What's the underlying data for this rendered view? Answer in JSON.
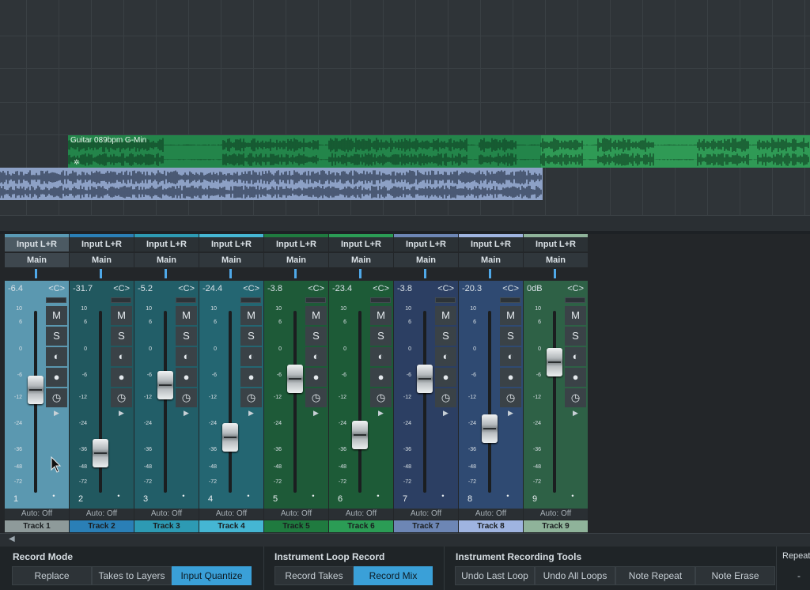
{
  "arrange": {
    "clips": [
      {
        "name": "Guitar 089bpm G-Min",
        "color": "#2f9a55"
      },
      {
        "name": "",
        "color": "#8da1c6"
      }
    ]
  },
  "mixer": {
    "channels": [
      {
        "input": "Input L+R",
        "output": "Main",
        "volume": "-6.4",
        "pan": "<C>",
        "fader_db": -6.4,
        "number": "1",
        "automation": "Auto: Off",
        "name": "Track 1",
        "strip_color": "#5b98b0",
        "name_color": "#8e9a9a",
        "top_color": "#5a9ab5"
      },
      {
        "input": "Input L+R",
        "output": "Main",
        "volume": "-31.7",
        "pan": "<C>",
        "fader_db": -31.7,
        "number": "2",
        "automation": "Auto: Off",
        "name": "Track 2",
        "strip_color": "#21585f",
        "name_color": "#2a7fb6",
        "top_color": "#2a7fb6"
      },
      {
        "input": "Input L+R",
        "output": "Main",
        "volume": "-5.2",
        "pan": "<C>",
        "fader_db": -5.2,
        "number": "3",
        "automation": "Auto: Off",
        "name": "Track 3",
        "strip_color": "#225e68",
        "name_color": "#2d9ab3",
        "top_color": "#2d9ab3"
      },
      {
        "input": "Input L+R",
        "output": "Main",
        "volume": "-24.4",
        "pan": "<C>",
        "fader_db": -24.4,
        "number": "4",
        "automation": "Auto: Off",
        "name": "Track 4",
        "strip_color": "#246672",
        "name_color": "#45b6d3",
        "top_color": "#45b6d3"
      },
      {
        "input": "Input L+R",
        "output": "Main",
        "volume": "-3.8",
        "pan": "<C>",
        "fader_db": -3.8,
        "number": "5",
        "automation": "Auto: Off",
        "name": "Track 5",
        "strip_color": "#1e5a38",
        "name_color": "#1f7a3f",
        "top_color": "#1f7a3f"
      },
      {
        "input": "Input L+R",
        "output": "Main",
        "volume": "-23.4",
        "pan": "<C>",
        "fader_db": -23.4,
        "number": "6",
        "automation": "Auto: Off",
        "name": "Track 6",
        "strip_color": "#1d5b37",
        "name_color": "#2b9c55",
        "top_color": "#2b9c55"
      },
      {
        "input": "Input L+R",
        "output": "Main",
        "volume": "-3.8",
        "pan": "<C>",
        "fader_db": -3.8,
        "number": "7",
        "automation": "Auto: Off",
        "name": "Track 7",
        "strip_color": "#2c3f63",
        "name_color": "#6d86b5",
        "top_color": "#6d86b5"
      },
      {
        "input": "Input L+R",
        "output": "Main",
        "volume": "-20.3",
        "pan": "<C>",
        "fader_db": -20.3,
        "number": "8",
        "automation": "Auto: Off",
        "name": "Track 8",
        "strip_color": "#2f4a72",
        "name_color": "#9fb4e0",
        "top_color": "#9fb4e0"
      },
      {
        "input": "Input L+R",
        "output": "Main",
        "volume": "0dB",
        "pan": "<C>",
        "fader_db": 0,
        "number": "9",
        "automation": "Auto: Off",
        "name": "Track 9",
        "strip_color": "#2e6146",
        "name_color": "#8fb39a",
        "top_color": "#8fb39a"
      }
    ],
    "scale": [
      "10",
      "6",
      "0",
      "-6",
      "-12",
      "-24",
      "-36",
      "-48",
      "-72"
    ],
    "buttons": [
      "M",
      "S",
      "◐",
      "●",
      "◷"
    ]
  },
  "bottom": {
    "record_mode": {
      "title": "Record Mode",
      "buttons": [
        {
          "label": "Replace",
          "active": false
        },
        {
          "label": "Takes to Layers",
          "active": false
        },
        {
          "label": "Input Quantize",
          "active": true
        }
      ]
    },
    "loop_record": {
      "title": "Instrument Loop Record",
      "buttons": [
        {
          "label": "Record Takes",
          "active": false
        },
        {
          "label": "Record Mix",
          "active": true
        }
      ]
    },
    "tools": {
      "title": "Instrument Recording Tools",
      "buttons": [
        {
          "label": "Undo Last Loop"
        },
        {
          "label": "Undo All Loops"
        },
        {
          "label": "Note Repeat"
        },
        {
          "label": "Note Erase"
        }
      ]
    },
    "repeat": {
      "title": "Repeat",
      "value": "-"
    }
  }
}
